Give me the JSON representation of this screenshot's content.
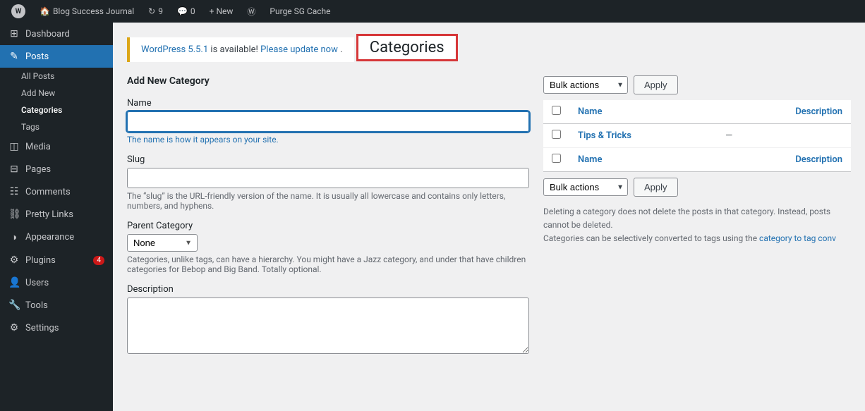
{
  "adminBar": {
    "wpIconLabel": "W",
    "siteName": "Blog Success Journal",
    "updatesCount": "9",
    "commentsCount": "0",
    "newLabel": "+ New",
    "purgeLabel": "Purge SG Cache",
    "wordpressIconLabel": "Ⓦ"
  },
  "sidebar": {
    "items": [
      {
        "id": "dashboard",
        "label": "Dashboard",
        "icon": "⊞",
        "active": false
      },
      {
        "id": "posts",
        "label": "Posts",
        "icon": "✎",
        "active": true
      },
      {
        "id": "all-posts",
        "label": "All Posts",
        "sub": true,
        "active": false
      },
      {
        "id": "add-new",
        "label": "Add New",
        "sub": true,
        "active": false
      },
      {
        "id": "categories",
        "label": "Categories",
        "sub": true,
        "active": true
      },
      {
        "id": "tags",
        "label": "Tags",
        "sub": true,
        "active": false
      },
      {
        "id": "media",
        "label": "Media",
        "icon": "◫",
        "active": false
      },
      {
        "id": "pages",
        "label": "Pages",
        "icon": "⊟",
        "active": false
      },
      {
        "id": "comments",
        "label": "Comments",
        "icon": "☷",
        "active": false
      },
      {
        "id": "pretty-links",
        "label": "Pretty Links",
        "icon": "⛓",
        "active": false
      },
      {
        "id": "appearance",
        "label": "Appearance",
        "icon": "◑",
        "active": false
      },
      {
        "id": "plugins",
        "label": "Plugins",
        "icon": "⚙",
        "active": false,
        "badge": "4"
      },
      {
        "id": "users",
        "label": "Users",
        "icon": "👤",
        "active": false
      },
      {
        "id": "tools",
        "label": "Tools",
        "icon": "🔧",
        "active": false
      },
      {
        "id": "settings",
        "label": "Settings",
        "icon": "⚙",
        "active": false
      }
    ]
  },
  "notice": {
    "linkText": "WordPress 5.5.1",
    "midText": " is available! ",
    "updateLinkText": "Please update now",
    "suffix": "."
  },
  "pageTitle": "Categories",
  "form": {
    "sectionTitle": "Add New Category",
    "nameLabel": "Name",
    "namePlaceholder": "",
    "nameHelp": "The name is how it appears on your site.",
    "slugLabel": "Slug",
    "slugPlaceholder": "",
    "slugHelp": "The “slug” is the URL-friendly version of the name. It is usually all lowercase and contains only letters, numbers, and hyphens.",
    "parentCategoryLabel": "Parent Category",
    "parentCategoryDefault": "None",
    "parentCategoryHelp": "Categories, unlike tags, can have a hierarchy. You might have a Jazz category, and under that have children categories for Bebop and Big Band. Totally optional.",
    "descriptionLabel": "Description"
  },
  "table": {
    "bulkActionsLabel": "Bulk actions",
    "applyLabel": "Apply",
    "columns": [
      {
        "id": "name",
        "label": "Name"
      },
      {
        "id": "description",
        "label": "Description"
      }
    ],
    "rows": [
      {
        "name": "Tips & Tricks",
        "description": "—"
      }
    ],
    "footerNote1": "Deleting a category does not delete the posts in that category. Instead, posts",
    "footerNote2": "cannot be deleted.",
    "footerNote3": "Categories can be selectively converted to tags using the ",
    "footerLinkText": "category to tag conv",
    "footerNote4": ""
  }
}
